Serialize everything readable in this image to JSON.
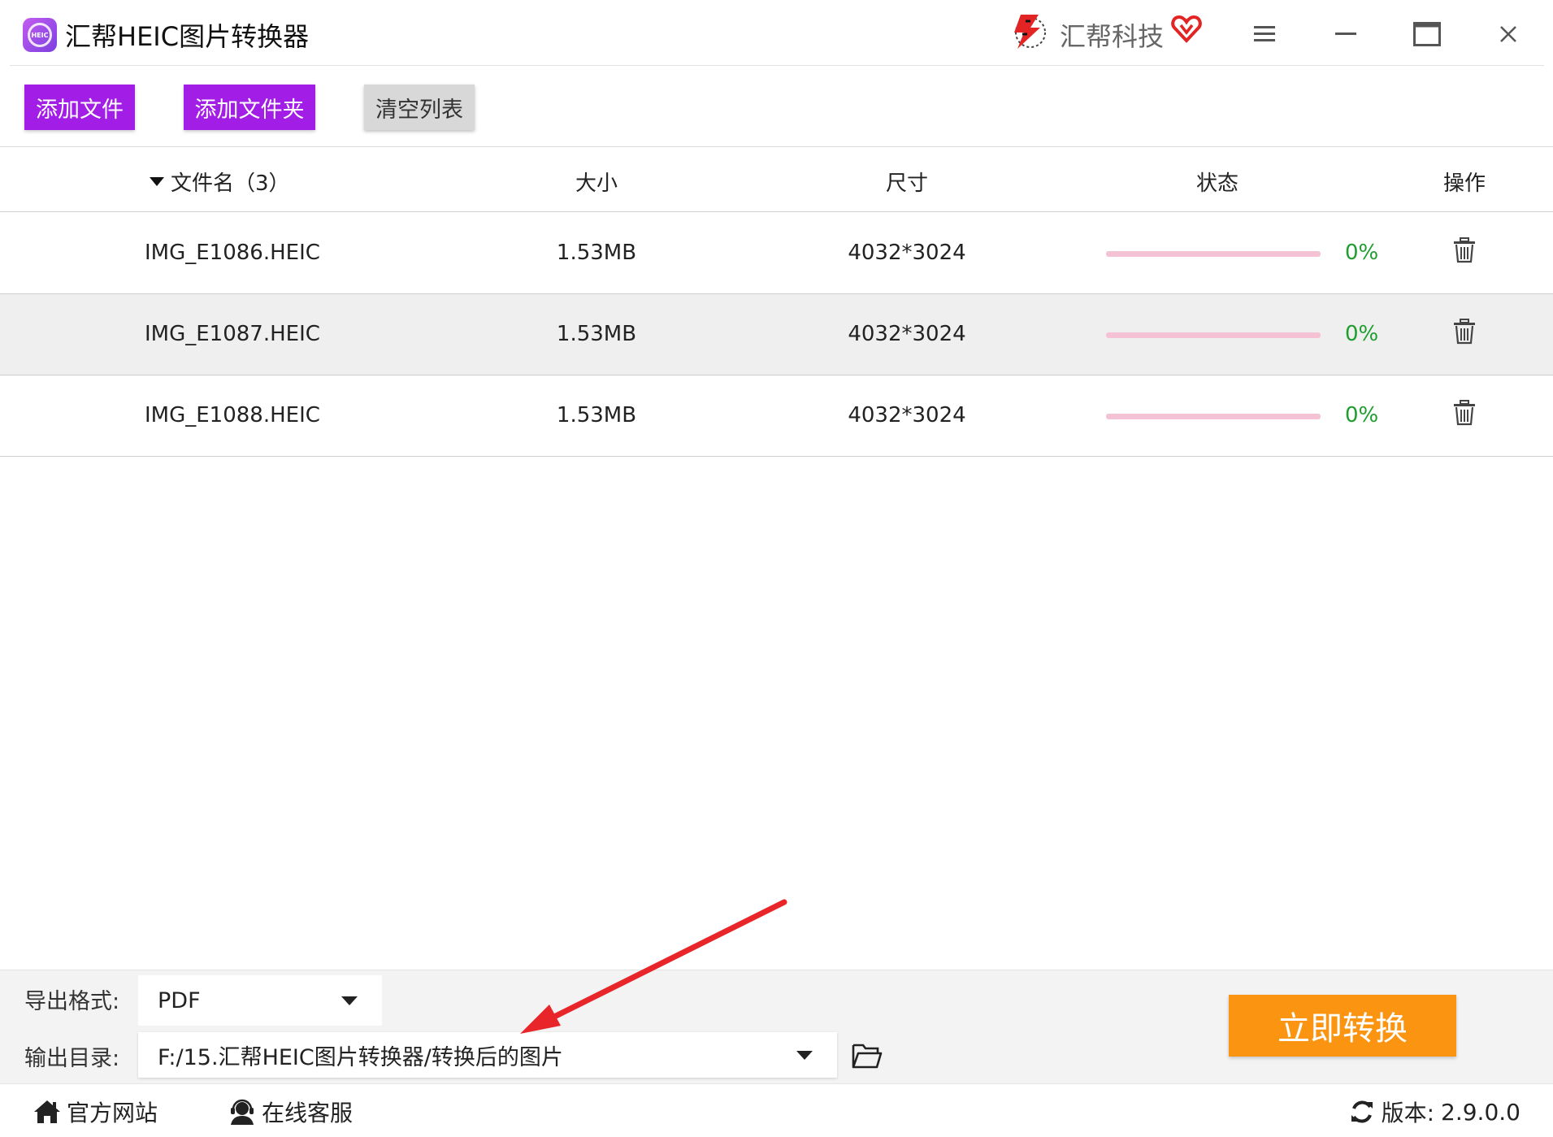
{
  "app": {
    "title": "汇帮HEIC图片转换器",
    "logo_icon": "heic-logo-icon",
    "logo_text": "HEIC"
  },
  "brand": {
    "name": "汇帮科技",
    "icon": "brand-lightning-icon",
    "vip_icon": "vip-heart-icon"
  },
  "window_controls": [
    "menu-icon",
    "minimize-icon",
    "maximize-icon",
    "close-icon"
  ],
  "toolbar": {
    "add_file_label": "添加文件",
    "add_folder_label": "添加文件夹",
    "clear_list_label": "清空列表"
  },
  "table": {
    "columns": {
      "name": "文件名（3）",
      "size": "大小",
      "dimensions": "尺寸",
      "status": "状态",
      "action": "操作"
    },
    "rows": [
      {
        "name": "IMG_E1086.HEIC",
        "size": "1.53MB",
        "dimensions": "4032*3024",
        "progress": 0,
        "progress_label": "0%"
      },
      {
        "name": "IMG_E1087.HEIC",
        "size": "1.53MB",
        "dimensions": "4032*3024",
        "progress": 0,
        "progress_label": "0%"
      },
      {
        "name": "IMG_E1088.HEIC",
        "size": "1.53MB",
        "dimensions": "4032*3024",
        "progress": 0,
        "progress_label": "0%"
      }
    ]
  },
  "export": {
    "format_label": "导出格式:",
    "format_value": "PDF",
    "output_label": "输出目录:",
    "output_value": "F:/15.汇帮HEIC图片转换器/转换后的图片"
  },
  "convert_label": "立即转换",
  "footer": {
    "website_label": "官方网站",
    "support_label": "在线客服",
    "version_label": "版本:",
    "version_value": "2.9.0.0"
  },
  "colors": {
    "accent_purple": "#a21ee6",
    "convert_orange": "#fa9411",
    "progress_pink": "#f4c2d4",
    "percent_green": "#1e9e2e",
    "annotation_red": "#e8262a"
  }
}
